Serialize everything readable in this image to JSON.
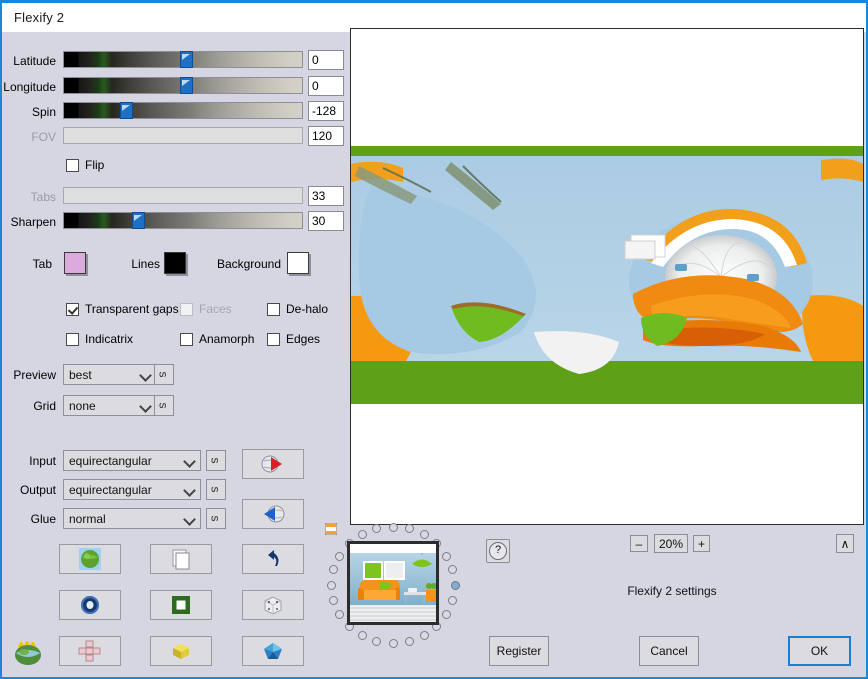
{
  "window": {
    "title": "Flexify 2"
  },
  "sliders": [
    {
      "label": "Latitude",
      "value": "0",
      "pos": 50,
      "disabled": false
    },
    {
      "label": "Longitude",
      "value": "0",
      "pos": 50,
      "disabled": false
    },
    {
      "label": "Spin",
      "value": "-128",
      "pos": 24,
      "disabled": false
    },
    {
      "label": "FOV",
      "value": "120",
      "pos": 0,
      "disabled": true
    },
    {
      "label": "Tabs",
      "value": "33",
      "pos": 0,
      "disabled": true
    },
    {
      "label": "Sharpen",
      "value": "30",
      "pos": 30,
      "disabled": false
    }
  ],
  "flip": {
    "label": "Flip",
    "checked": false
  },
  "swatches": [
    {
      "label": "Tab",
      "color": "#ddaadd"
    },
    {
      "label": "Lines",
      "color": "#000000"
    },
    {
      "label": "Background",
      "color": "#ffffff"
    }
  ],
  "checkboxes": [
    {
      "label": "Transparent gaps",
      "checked": true,
      "disabled": false
    },
    {
      "label": "Faces",
      "checked": false,
      "disabled": true
    },
    {
      "label": "De-halo",
      "checked": false,
      "disabled": false
    },
    {
      "label": "Indicatrix",
      "checked": false,
      "disabled": false
    },
    {
      "label": "Anamorph",
      "checked": false,
      "disabled": false
    },
    {
      "label": "Edges",
      "checked": false,
      "disabled": false
    }
  ],
  "selects": [
    {
      "label": "Preview",
      "value": "best",
      "reset_icon": "rotate-icon"
    },
    {
      "label": "Grid",
      "value": "none",
      "reset_icon": "rotate-icon"
    },
    {
      "label": "Input",
      "value": "equirectangular",
      "reset_icon": "rotate-icon"
    },
    {
      "label": "Output",
      "value": "equirectangular",
      "reset_icon": "rotate-icon"
    },
    {
      "label": "Glue",
      "value": "normal",
      "reset_icon": "rotate-icon"
    }
  ],
  "nav_buttons": [
    {
      "name": "globe-forward-button",
      "icon": "globe-red-arrow-icon"
    },
    {
      "name": "globe-back-button",
      "icon": "globe-blue-arrow-icon"
    }
  ],
  "icon_grid": [
    {
      "name": "sphere-button",
      "icon": "green-globe-icon"
    },
    {
      "name": "plane-button",
      "icon": "paper-sheet-icon"
    },
    {
      "name": "undo-button",
      "icon": "undo-arrow-icon"
    },
    {
      "name": "torus-button",
      "icon": "blue-torus-icon"
    },
    {
      "name": "frame-button",
      "icon": "green-square-frame-icon"
    },
    {
      "name": "dice-button",
      "icon": "white-dice-icon"
    },
    {
      "name": "cross-button",
      "icon": "pink-cross-net-icon"
    },
    {
      "name": "cube-button",
      "icon": "yellow-cube-icon"
    },
    {
      "name": "dodecahedron-button",
      "icon": "blue-polyhedron-icon"
    }
  ],
  "logo": {
    "name": "flexify-flame-globe-logo"
  },
  "thumbnail": {
    "name": "source-image-thumbnail",
    "alt": "living room interior"
  },
  "ring": {
    "dot_count": 24,
    "selected_index": 6
  },
  "help": {
    "label": "?"
  },
  "zoom": {
    "minus": "–",
    "value": "20%",
    "plus": "+"
  },
  "collapse": {
    "label": "∧"
  },
  "settings_label": "Flexify 2 settings",
  "buttons": {
    "register": "Register",
    "cancel": "Cancel",
    "ok": "OK"
  },
  "colors": {
    "panel": "#d6d6e2",
    "accent": "#1c86d8",
    "control": "#dcdce0",
    "field": "#ffffff"
  }
}
